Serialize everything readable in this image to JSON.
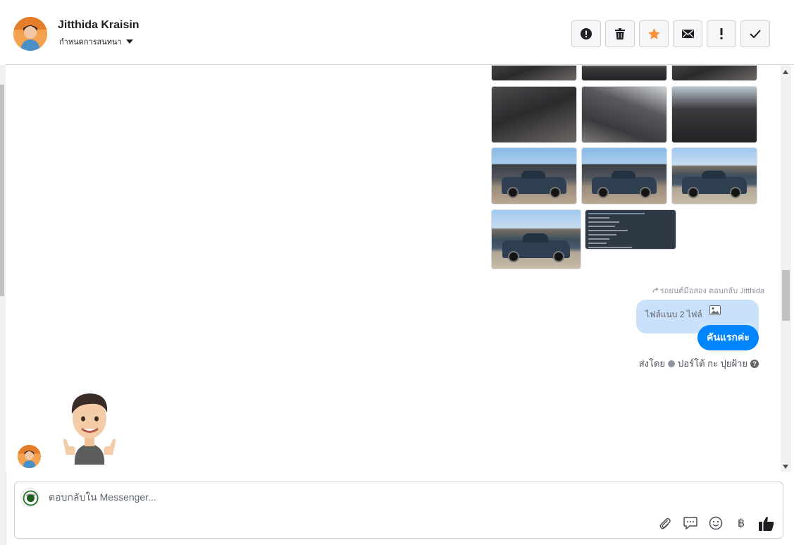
{
  "header": {
    "user_name": "Jitthida Kraisin",
    "conversation_settings": "กำหนดการสนทนา",
    "toolbar": [
      {
        "name": "report-spam-button",
        "icon": "alert-circle-icon"
      },
      {
        "name": "delete-button",
        "icon": "trash-icon"
      },
      {
        "name": "star-button",
        "icon": "star-icon"
      },
      {
        "name": "mark-unread-button",
        "icon": "envelope-icon"
      },
      {
        "name": "follow-up-button",
        "icon": "exclamation-icon"
      },
      {
        "name": "mark-done-button",
        "icon": "checkmark-icon"
      }
    ]
  },
  "thread": {
    "forwarded_label": "รถยนต์มือสอง ตอบกลับ Jitthida",
    "reply_preview": "ไฟล์แนบ 2 ไฟล์",
    "message": "คันแรกค่ะ",
    "sent_by_prefix": "ส่งโดย",
    "sent_by_name": "ปอร์โต้ กะ ปุยฝ้าย",
    "help_mark": "?"
  },
  "composer": {
    "placeholder": "ตอบกลับใน Messenger...",
    "currency_symbol": "฿"
  },
  "colors": {
    "accent": "#0084ff",
    "star": "#f7923a",
    "reply_bubble": "#c9e1fb"
  }
}
